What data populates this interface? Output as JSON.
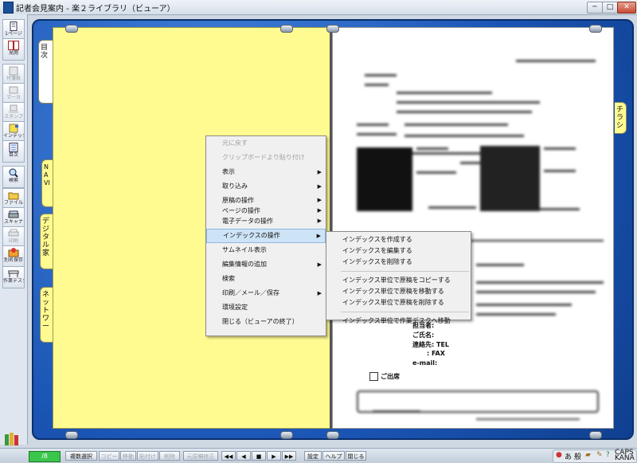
{
  "window": {
    "title": "記者会見案内 - 楽２ライブラリ（ビューア）",
    "buttons": {
      "minimize": "─",
      "restore": "□",
      "close": "✕"
    }
  },
  "toolbar": [
    {
      "label": "1ページ",
      "icon": "single-page-icon",
      "enabled": true
    },
    {
      "label": "見開",
      "icon": "spread-pages-icon",
      "enabled": true
    },
    {
      "label": "付箋紙",
      "icon": "sticky-note-icon",
      "enabled": false
    },
    {
      "label": "マーカ",
      "icon": "marker-icon",
      "enabled": false
    },
    {
      "label": "スタンプ",
      "icon": "stamp-icon",
      "enabled": false
    },
    {
      "label": "インデックス",
      "icon": "index-icon",
      "enabled": true
    },
    {
      "label": "目次",
      "icon": "toc-icon",
      "enabled": true
    },
    {
      "label": "検索",
      "icon": "magnifier-icon",
      "enabled": true
    },
    {
      "label": "ファイル",
      "icon": "folder-icon",
      "enabled": true
    },
    {
      "label": "スキャナ",
      "icon": "scanner-icon",
      "enabled": true
    },
    {
      "label": "印刷",
      "icon": "printer-icon",
      "enabled": false
    },
    {
      "label": "別名保存",
      "icon": "save-as-icon",
      "enabled": true
    },
    {
      "label": "作業デスク",
      "icon": "work-desk-icon",
      "enabled": true
    }
  ],
  "tabs": {
    "left": [
      {
        "label": "目次"
      },
      {
        "label": "NAVI"
      },
      {
        "label": "デジタル家"
      },
      {
        "label": "ネットワー"
      }
    ],
    "right": {
      "label": "チラシ"
    }
  },
  "context_menu": {
    "items": [
      {
        "label": "元に戻す",
        "enabled": false,
        "submenu": false
      },
      {
        "label": "クリップボードより貼り付け",
        "enabled": false,
        "submenu": false
      },
      {
        "label": "表示",
        "enabled": true,
        "submenu": true
      },
      {
        "label": "取り込み",
        "enabled": true,
        "submenu": true
      },
      {
        "label": "原稿の操作",
        "enabled": true,
        "submenu": true
      },
      {
        "label": "ページの操作",
        "enabled": true,
        "submenu": true
      },
      {
        "label": "電子データの操作",
        "enabled": true,
        "submenu": true
      },
      {
        "label": "インデックスの操作",
        "enabled": true,
        "submenu": true,
        "selected": true
      },
      {
        "label": "サムネイル表示",
        "enabled": true,
        "submenu": false
      },
      {
        "label": "編集情報の追加",
        "enabled": true,
        "submenu": true
      },
      {
        "label": "検索",
        "enabled": true,
        "submenu": false
      },
      {
        "label": "印刷／メール／保存",
        "enabled": true,
        "submenu": true
      },
      {
        "label": "環境設定",
        "enabled": true,
        "submenu": false
      },
      {
        "label": "閉じる（ビューアの終了）",
        "enabled": true,
        "submenu": false
      }
    ]
  },
  "submenu": {
    "groups": [
      [
        "インデックスを作成する",
        "インデックスを編集する",
        "インデックスを削除する"
      ],
      [
        "インデックス単位で原稿をコピーする",
        "インデックス単位で原稿を移動する",
        "インデックス単位で原稿を削除する"
      ],
      [
        "インデックス単位で作業デスクへ移動"
      ]
    ]
  },
  "document": {
    "fields": [
      "担当者:",
      "ご氏名:",
      "連絡先: TEL",
      ": FAX",
      "e-mail:"
    ],
    "checkbox_label": "ご出席"
  },
  "statusbar": {
    "page": "/8",
    "buttons": [
      {
        "label": "複数選択",
        "enabled": true
      },
      {
        "label": "コピー",
        "enabled": false
      },
      {
        "label": "移動",
        "enabled": false
      },
      {
        "label": "貼付け",
        "enabled": false
      },
      {
        "label": "削除",
        "enabled": false
      },
      {
        "label": "元原稿修正",
        "enabled": false
      }
    ],
    "nav": [
      "◀◀",
      "◀",
      "■",
      "▶",
      "▶▶"
    ],
    "right_buttons": [
      "設定",
      "ヘルプ",
      "閉じる"
    ],
    "tray": {
      "ime": "あ",
      "ime_mode": "般",
      "caps_line1": "CAPS",
      "caps_line2": "KANA"
    }
  }
}
